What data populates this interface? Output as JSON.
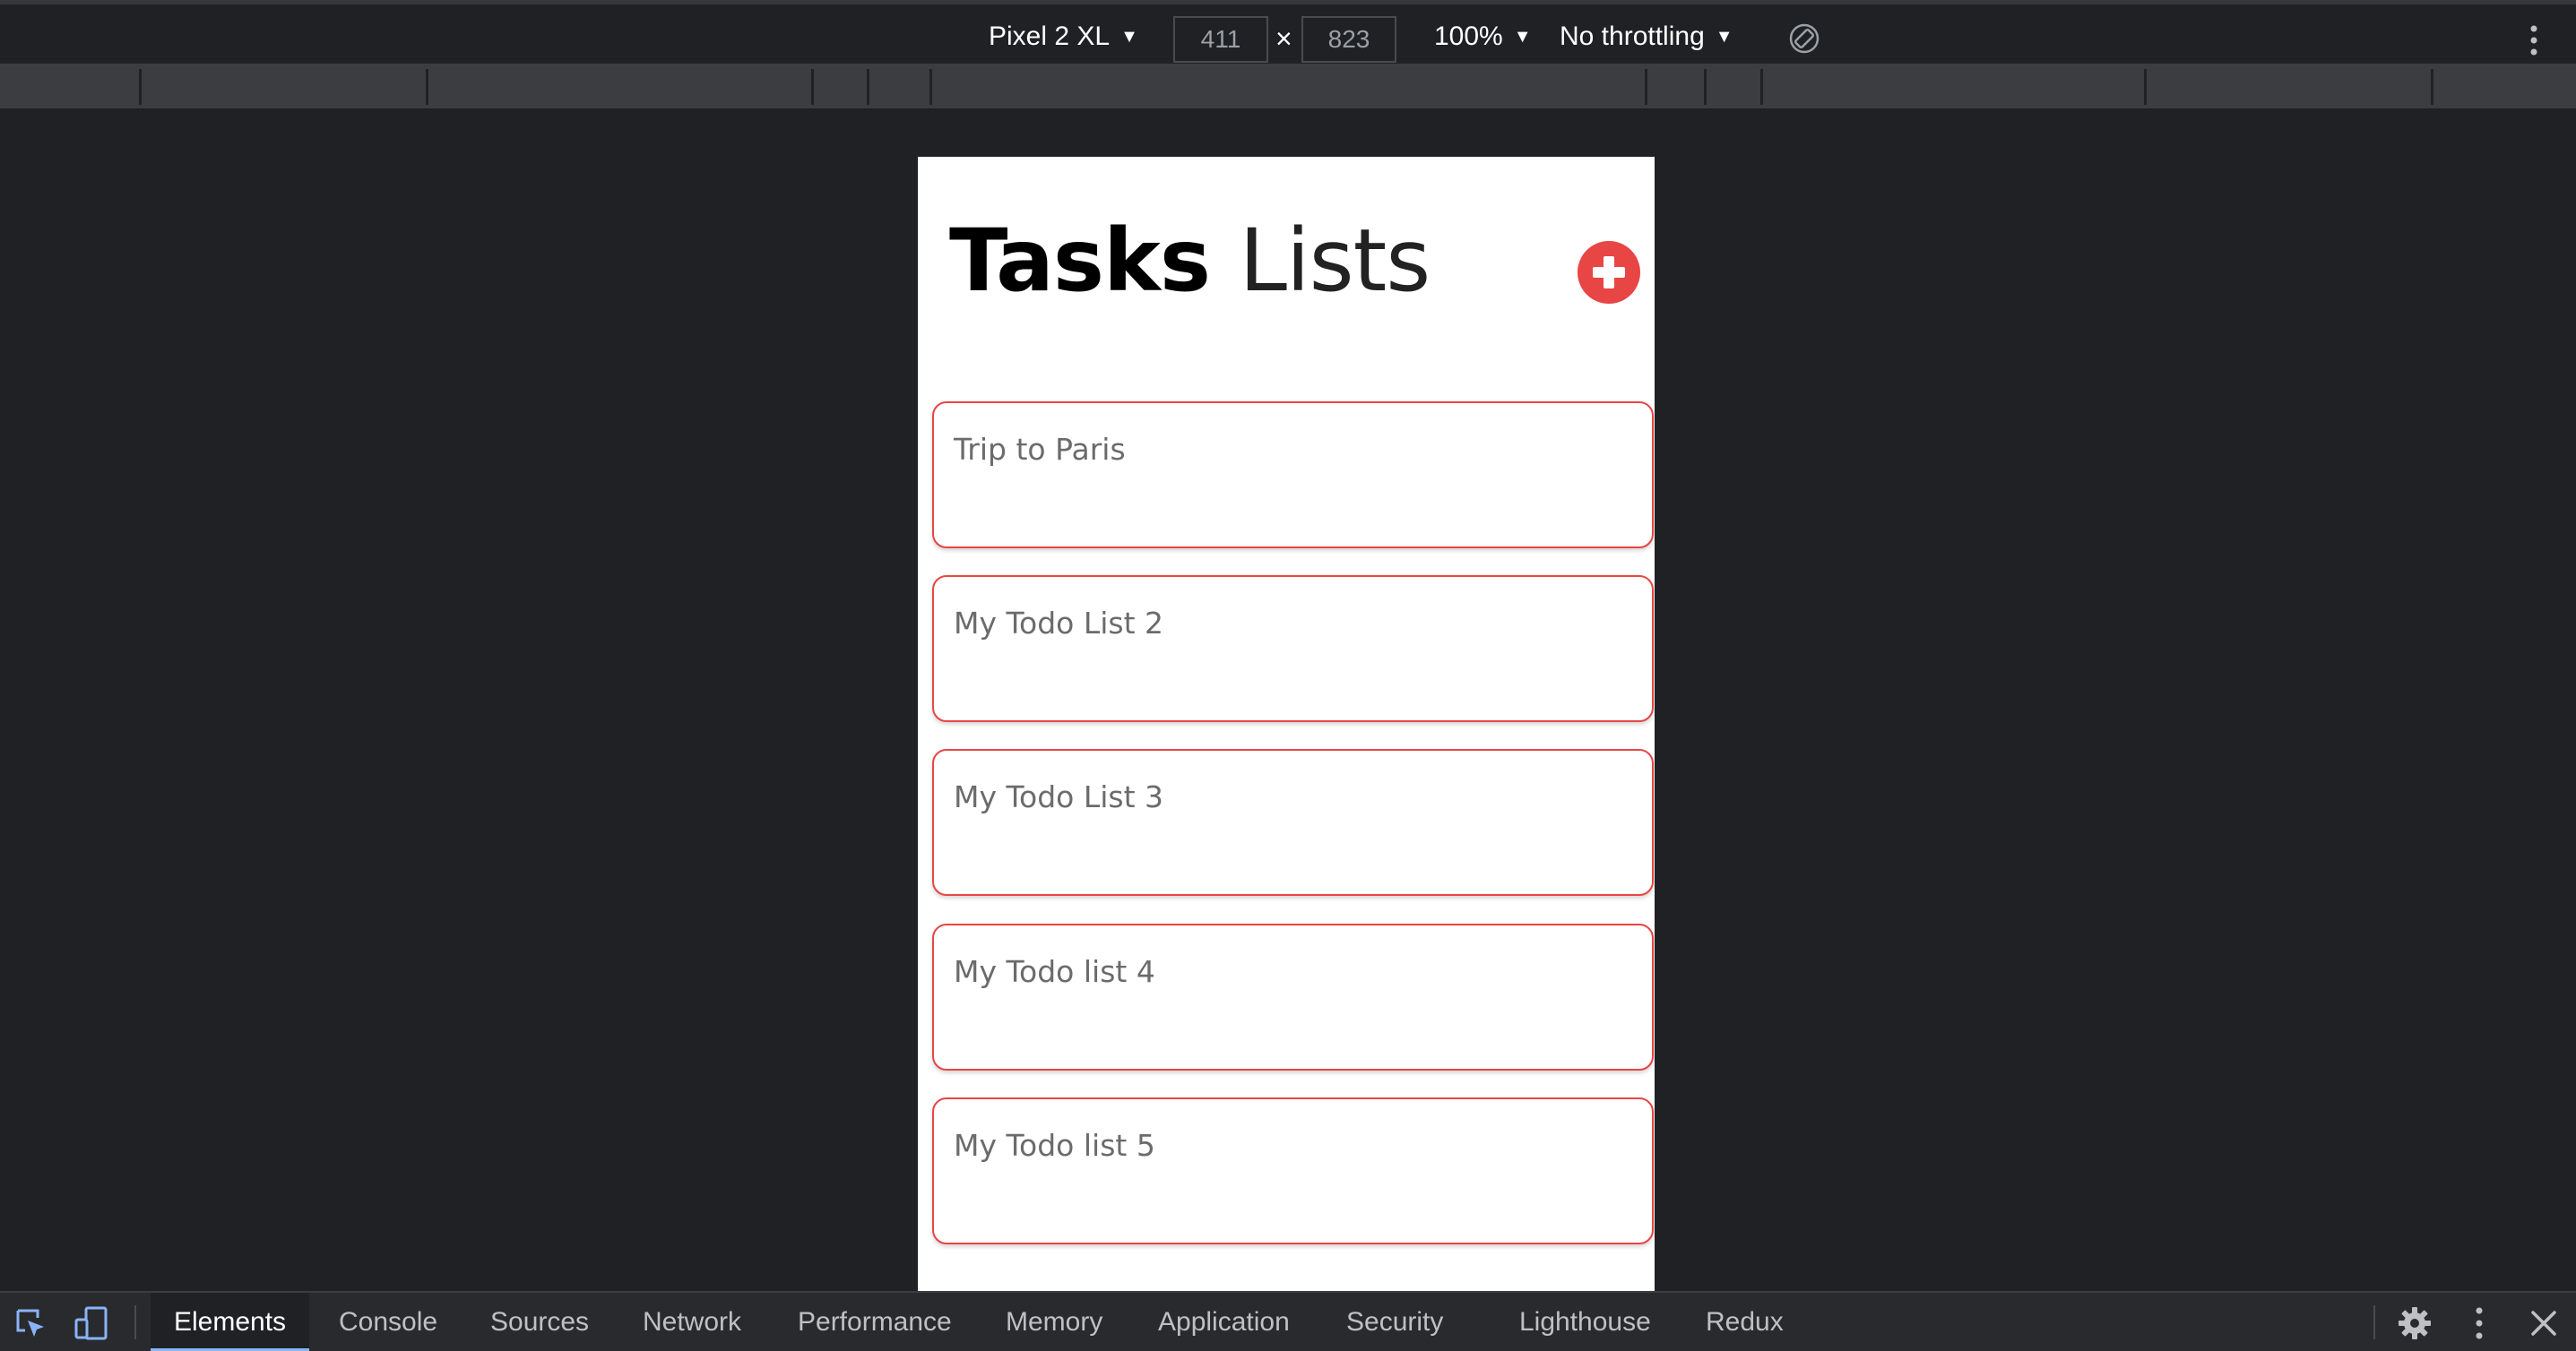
{
  "toolbar": {
    "device": "Pixel 2 XL",
    "width": "411",
    "height": "823",
    "times": "×",
    "zoom": "100%",
    "throttling": "No throttling",
    "caret": "▼"
  },
  "app": {
    "title_bold": "Tasks",
    "title_light": "Lists",
    "accent_color": "#e84545",
    "lists": [
      {
        "title": "Trip to Paris"
      },
      {
        "title": "My Todo List 2"
      },
      {
        "title": "My Todo List 3"
      },
      {
        "title": "My Todo list 4"
      },
      {
        "title": "My Todo list 5"
      }
    ]
  },
  "devtools": {
    "active_color": "#8ab4f8",
    "tabs": [
      {
        "label": "Elements"
      },
      {
        "label": "Console"
      },
      {
        "label": "Sources"
      },
      {
        "label": "Network"
      },
      {
        "label": "Performance"
      },
      {
        "label": "Memory"
      },
      {
        "label": "Application"
      },
      {
        "label": "Security"
      },
      {
        "label": "Lighthouse"
      },
      {
        "label": "Redux"
      }
    ],
    "icons": [
      "inspect-element-icon",
      "device-toggle-icon",
      "gear-icon",
      "kebab-menu-icon",
      "close-icon"
    ]
  }
}
